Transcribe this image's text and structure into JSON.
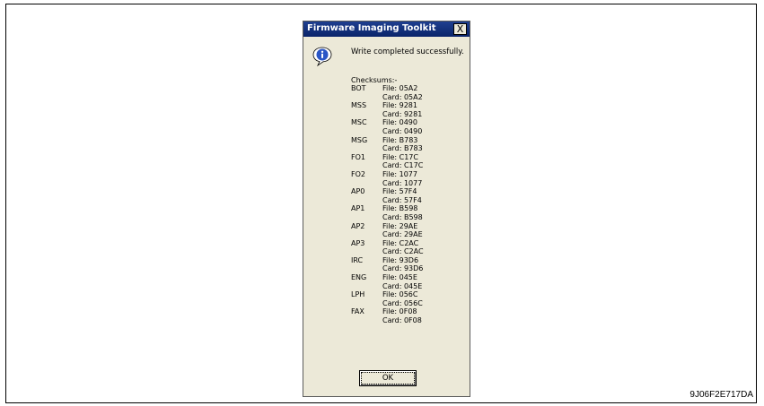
{
  "dialog": {
    "title": "Firmware Imaging Toolkit",
    "close_label": "X",
    "message": "Write completed successfully.",
    "checksums_heading": "Checksums:-",
    "checksums": [
      {
        "name": "BOT",
        "file": "File: 05A2",
        "card": "Card: 05A2"
      },
      {
        "name": "MSS",
        "file": "File: 9281",
        "card": "Card: 9281"
      },
      {
        "name": "MSC",
        "file": "File: 0490",
        "card": "Card: 0490"
      },
      {
        "name": "MSG",
        "file": "File: B783",
        "card": "Card: B783"
      },
      {
        "name": "FO1",
        "file": "File: C17C",
        "card": "Card: C17C"
      },
      {
        "name": "FO2",
        "file": "File: 1077",
        "card": "Card: 1077"
      },
      {
        "name": "AP0",
        "file": "File: 57F4",
        "card": "Card: 57F4"
      },
      {
        "name": "AP1",
        "file": "File: B598",
        "card": "Card: B598"
      },
      {
        "name": "AP2",
        "file": "File: 29AE",
        "card": "Card: 29AE"
      },
      {
        "name": "AP3",
        "file": "File: C2AC",
        "card": "Card: C2AC"
      },
      {
        "name": "IRC",
        "file": "File: 93D6",
        "card": "Card: 93D6"
      },
      {
        "name": "ENG",
        "file": "File: 045E",
        "card": "Card: 045E"
      },
      {
        "name": "LPH",
        "file": "File: 056C",
        "card": "Card: 056C"
      },
      {
        "name": "FAX",
        "file": "File: 0F08",
        "card": "Card: 0F08"
      }
    ],
    "ok_label": "OK"
  },
  "caption": "9J06F2E717DA",
  "icons": {
    "info": "info-icon",
    "close": "close-icon"
  },
  "colors": {
    "titlebar": "#0a246a",
    "dialog_bg": "#ece9d8"
  }
}
